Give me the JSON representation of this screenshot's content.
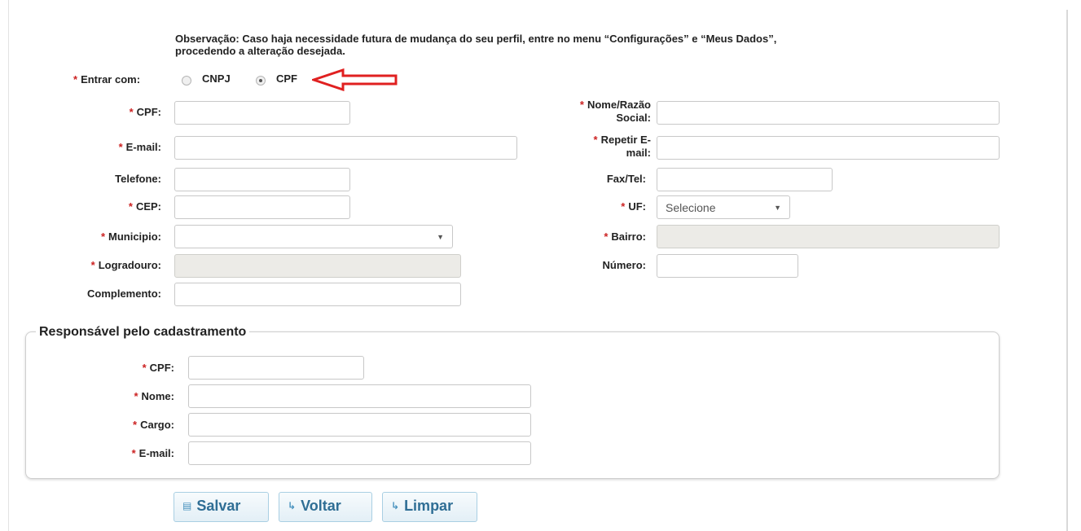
{
  "note": {
    "line1": "Observação: Caso haja necessidade futura de mudança do seu perfil, entre no menu “Configurações” e “Meus Dados”,",
    "line2": "procedendo a alteração desejada."
  },
  "required_mark": "*",
  "entrar": {
    "label": "Entrar com:",
    "options": [
      "CNPJ",
      "CPF"
    ],
    "selected": "CPF"
  },
  "fields": {
    "cpf": "CPF:",
    "nome_razao_line1": "Nome/Razão",
    "nome_razao_line2": "Social:",
    "email": "E-mail:",
    "repetir_email_line1": "Repetir E-",
    "repetir_email_line2": "mail:",
    "telefone": "Telefone:",
    "fax": "Fax/Tel:",
    "cep": "CEP:",
    "uf": "UF:",
    "uf_value": "Selecione",
    "municipio": "Municipio:",
    "bairro": "Bairro:",
    "logradouro": "Logradouro:",
    "numero": "Número:",
    "complemento": "Complemento:"
  },
  "responsavel": {
    "legend": "Responsável pelo cadastramento",
    "cpf": "CPF:",
    "nome": "Nome:",
    "cargo": "Cargo:",
    "email": "E-mail:"
  },
  "buttons": {
    "salvar": "Salvar",
    "voltar": "Voltar",
    "limpar": "Limpar"
  },
  "colors": {
    "required": "#cc2222",
    "arrow": "#e02020",
    "button_text": "#2f6e95",
    "disabled_field": "#ecebe7"
  },
  "icons": {
    "salvar": "floppy-disk-icon",
    "voltar": "return-arrow-icon",
    "limpar": "return-arrow-icon",
    "select": "caret-down-icon",
    "annotation": "left-arrow-annotation"
  }
}
